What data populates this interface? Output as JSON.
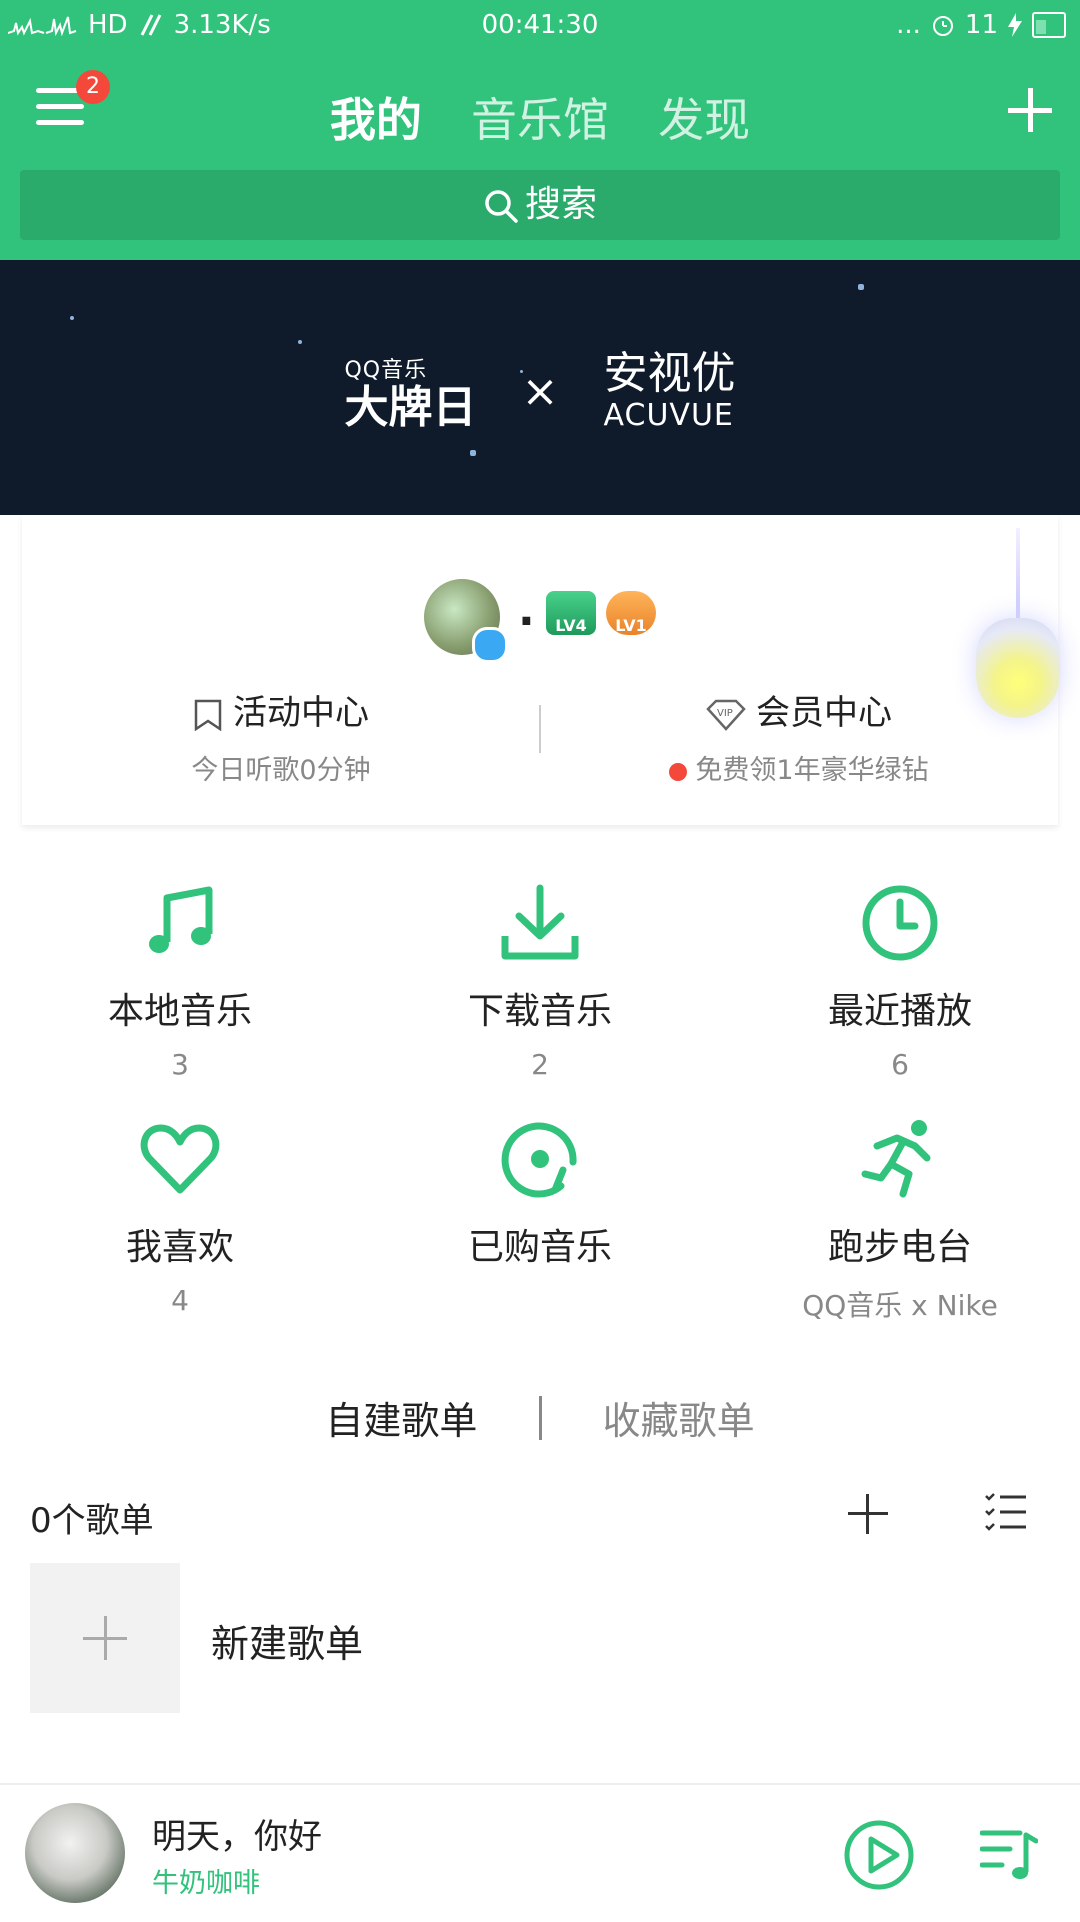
{
  "status_bar": {
    "network": "HD",
    "speed": "3.13K/s",
    "time": "00:41:30",
    "dots": "...",
    "battery_level": "11"
  },
  "nav": {
    "badge": "2",
    "tabs": [
      "我的",
      "音乐馆",
      "发现"
    ],
    "active_tab": "我的"
  },
  "search": {
    "label": "搜索"
  },
  "banner": {
    "qq_small": "QQ音乐",
    "qq_big": "大牌日",
    "x": "×",
    "partner_cn": "安视优",
    "partner_en": "ACUVUE"
  },
  "profile": {
    "username": ".",
    "level_badges": [
      "LV4",
      "LV1"
    ],
    "activity": {
      "title": "活动中心",
      "subtitle": "今日听歌0分钟"
    },
    "vip": {
      "title": "会员中心",
      "subtitle": "免费领1年豪华绿钻"
    }
  },
  "grid": [
    {
      "label": "本地音乐",
      "count": "3",
      "icon": "music-note-icon"
    },
    {
      "label": "下载音乐",
      "count": "2",
      "icon": "download-icon"
    },
    {
      "label": "最近播放",
      "count": "6",
      "icon": "clock-icon"
    },
    {
      "label": "我喜欢",
      "count": "4",
      "icon": "heart-icon"
    },
    {
      "label": "已购音乐",
      "count": "",
      "icon": "purchased-disc-icon"
    },
    {
      "label": "跑步电台",
      "count": "QQ音乐 x Nike",
      "icon": "runner-icon"
    }
  ],
  "playlists": {
    "tabs": [
      "自建歌单",
      "收藏歌单"
    ],
    "count_label": "0个歌单",
    "new_label": "新建歌单"
  },
  "player": {
    "title": "明天，你好",
    "artist": "牛奶咖啡"
  },
  "colors": {
    "brand_green": "#31c27c",
    "search_green": "#2aab6c",
    "banner_bg": "#0f1a2b",
    "badge_red": "#f4483b"
  }
}
